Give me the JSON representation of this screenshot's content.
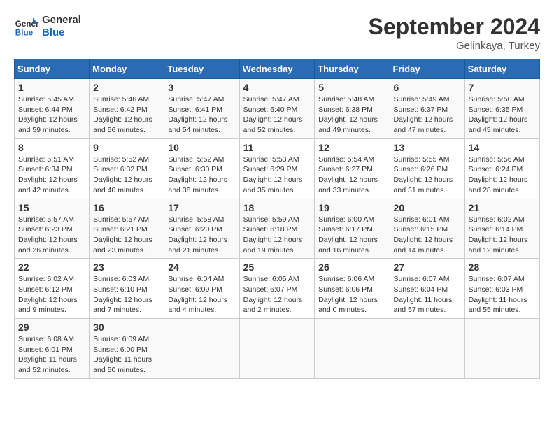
{
  "header": {
    "logo_line1": "General",
    "logo_line2": "Blue",
    "title": "September 2024",
    "location": "Gelinkaya, Turkey"
  },
  "days_of_week": [
    "Sunday",
    "Monday",
    "Tuesday",
    "Wednesday",
    "Thursday",
    "Friday",
    "Saturday"
  ],
  "weeks": [
    [
      {
        "num": "1",
        "info": "Sunrise: 5:45 AM\nSunset: 6:44 PM\nDaylight: 12 hours\nand 59 minutes."
      },
      {
        "num": "2",
        "info": "Sunrise: 5:46 AM\nSunset: 6:42 PM\nDaylight: 12 hours\nand 56 minutes."
      },
      {
        "num": "3",
        "info": "Sunrise: 5:47 AM\nSunset: 6:41 PM\nDaylight: 12 hours\nand 54 minutes."
      },
      {
        "num": "4",
        "info": "Sunrise: 5:47 AM\nSunset: 6:40 PM\nDaylight: 12 hours\nand 52 minutes."
      },
      {
        "num": "5",
        "info": "Sunrise: 5:48 AM\nSunset: 6:38 PM\nDaylight: 12 hours\nand 49 minutes."
      },
      {
        "num": "6",
        "info": "Sunrise: 5:49 AM\nSunset: 6:37 PM\nDaylight: 12 hours\nand 47 minutes."
      },
      {
        "num": "7",
        "info": "Sunrise: 5:50 AM\nSunset: 6:35 PM\nDaylight: 12 hours\nand 45 minutes."
      }
    ],
    [
      {
        "num": "8",
        "info": "Sunrise: 5:51 AM\nSunset: 6:34 PM\nDaylight: 12 hours\nand 42 minutes."
      },
      {
        "num": "9",
        "info": "Sunrise: 5:52 AM\nSunset: 6:32 PM\nDaylight: 12 hours\nand 40 minutes."
      },
      {
        "num": "10",
        "info": "Sunrise: 5:52 AM\nSunset: 6:30 PM\nDaylight: 12 hours\nand 38 minutes."
      },
      {
        "num": "11",
        "info": "Sunrise: 5:53 AM\nSunset: 6:29 PM\nDaylight: 12 hours\nand 35 minutes."
      },
      {
        "num": "12",
        "info": "Sunrise: 5:54 AM\nSunset: 6:27 PM\nDaylight: 12 hours\nand 33 minutes."
      },
      {
        "num": "13",
        "info": "Sunrise: 5:55 AM\nSunset: 6:26 PM\nDaylight: 12 hours\nand 31 minutes."
      },
      {
        "num": "14",
        "info": "Sunrise: 5:56 AM\nSunset: 6:24 PM\nDaylight: 12 hours\nand 28 minutes."
      }
    ],
    [
      {
        "num": "15",
        "info": "Sunrise: 5:57 AM\nSunset: 6:23 PM\nDaylight: 12 hours\nand 26 minutes."
      },
      {
        "num": "16",
        "info": "Sunrise: 5:57 AM\nSunset: 6:21 PM\nDaylight: 12 hours\nand 23 minutes."
      },
      {
        "num": "17",
        "info": "Sunrise: 5:58 AM\nSunset: 6:20 PM\nDaylight: 12 hours\nand 21 minutes."
      },
      {
        "num": "18",
        "info": "Sunrise: 5:59 AM\nSunset: 6:18 PM\nDaylight: 12 hours\nand 19 minutes."
      },
      {
        "num": "19",
        "info": "Sunrise: 6:00 AM\nSunset: 6:17 PM\nDaylight: 12 hours\nand 16 minutes."
      },
      {
        "num": "20",
        "info": "Sunrise: 6:01 AM\nSunset: 6:15 PM\nDaylight: 12 hours\nand 14 minutes."
      },
      {
        "num": "21",
        "info": "Sunrise: 6:02 AM\nSunset: 6:14 PM\nDaylight: 12 hours\nand 12 minutes."
      }
    ],
    [
      {
        "num": "22",
        "info": "Sunrise: 6:02 AM\nSunset: 6:12 PM\nDaylight: 12 hours\nand 9 minutes."
      },
      {
        "num": "23",
        "info": "Sunrise: 6:03 AM\nSunset: 6:10 PM\nDaylight: 12 hours\nand 7 minutes."
      },
      {
        "num": "24",
        "info": "Sunrise: 6:04 AM\nSunset: 6:09 PM\nDaylight: 12 hours\nand 4 minutes."
      },
      {
        "num": "25",
        "info": "Sunrise: 6:05 AM\nSunset: 6:07 PM\nDaylight: 12 hours\nand 2 minutes."
      },
      {
        "num": "26",
        "info": "Sunrise: 6:06 AM\nSunset: 6:06 PM\nDaylight: 12 hours\nand 0 minutes."
      },
      {
        "num": "27",
        "info": "Sunrise: 6:07 AM\nSunset: 6:04 PM\nDaylight: 11 hours\nand 57 minutes."
      },
      {
        "num": "28",
        "info": "Sunrise: 6:07 AM\nSunset: 6:03 PM\nDaylight: 11 hours\nand 55 minutes."
      }
    ],
    [
      {
        "num": "29",
        "info": "Sunrise: 6:08 AM\nSunset: 6:01 PM\nDaylight: 11 hours\nand 52 minutes."
      },
      {
        "num": "30",
        "info": "Sunrise: 6:09 AM\nSunset: 6:00 PM\nDaylight: 11 hours\nand 50 minutes."
      },
      {
        "num": "",
        "info": ""
      },
      {
        "num": "",
        "info": ""
      },
      {
        "num": "",
        "info": ""
      },
      {
        "num": "",
        "info": ""
      },
      {
        "num": "",
        "info": ""
      }
    ]
  ]
}
